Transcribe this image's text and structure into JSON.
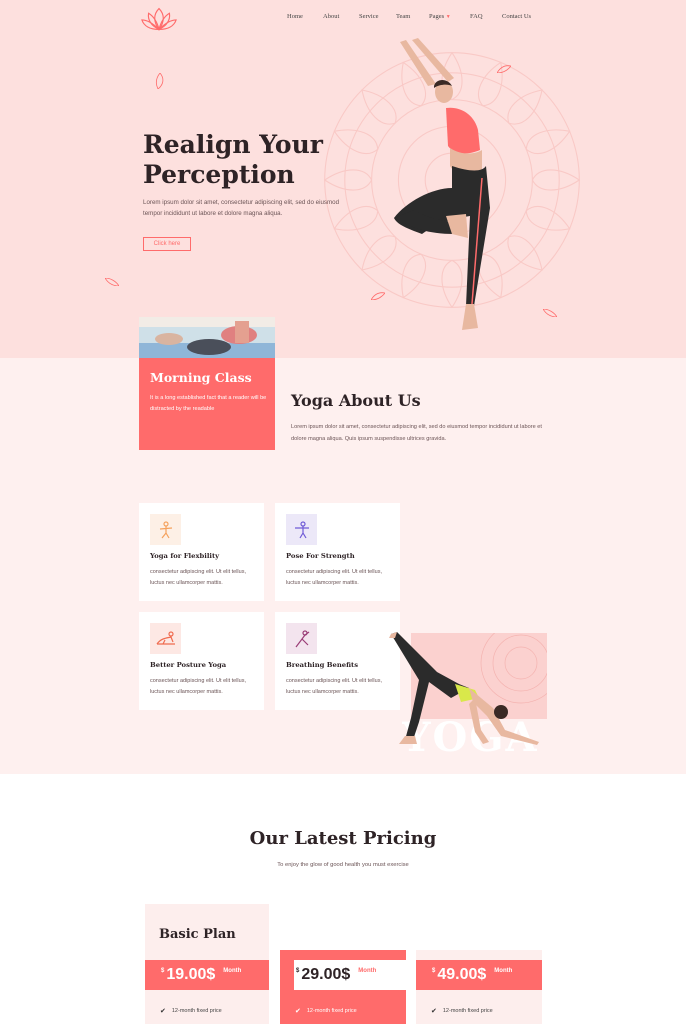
{
  "nav": {
    "items": [
      "Home",
      "About",
      "Service",
      "Team",
      "Pages",
      "FAQ",
      "Contact Us"
    ]
  },
  "hero": {
    "title_line1": "Realign Your",
    "title_line2": "Perception",
    "text": "Lorem ipsum dolor sit amet, consectetur adipiscing elit, sed do eiusmod tempor incididunt ut labore et dolore magna aliqua.",
    "button": "Click here"
  },
  "morning": {
    "title": "Morning Class",
    "text": "It is a long established fact that a reader will be distracted by the readable"
  },
  "about": {
    "title": "Yoga About Us",
    "text": "Lorem ipsum dolor sit amet, consectetur adipiscing elit, sed do eiusmod tempor incididunt ut labore et dolore magna aliqua. Quis ipsum suspendisse ultrices gravida."
  },
  "services": [
    {
      "title": "Yoga for Flexbility",
      "text": "consectetur adipiscing elit. Ut elit tellus, luctus nec ullamcorper mattis.",
      "icon": "yoga-pose-icon"
    },
    {
      "title": "Pose For Strength",
      "text": "consectetur adipiscing elit. Ut elit tellus, luctus nec ullamcorper mattis.",
      "icon": "strength-pose-icon"
    },
    {
      "title": "Better Posture Yoga",
      "text": "consectetur adipiscing elit. Ut elit tellus, luctus nec ullamcorper mattis.",
      "icon": "posture-icon"
    },
    {
      "title": "Breathing Benefits",
      "text": "consectetur adipiscing elit. Ut elit tellus, luctus nec ullamcorper mattis.",
      "icon": "breathing-icon"
    }
  ],
  "yoga_word": "YOGA",
  "pricing": {
    "title": "Our Latest Pricing",
    "subtitle": "To enjoy the glow of good health you must exercise",
    "plans": [
      {
        "name": "Basic Plan",
        "currency": "$",
        "price": "19.00$",
        "period": "Month",
        "feature": "12-month fixed price"
      },
      {
        "name": "",
        "currency": "$",
        "price": "29.00$",
        "period": "Month",
        "feature": "12-month fixed price"
      },
      {
        "name": "",
        "currency": "$",
        "price": "49.00$",
        "period": "Month",
        "feature": "12-month fixed price"
      }
    ]
  },
  "colors": {
    "accent": "#ff6b6b",
    "hero_bg": "#fde0de",
    "section_bg": "#fef0ef",
    "dark": "#2e2326"
  }
}
